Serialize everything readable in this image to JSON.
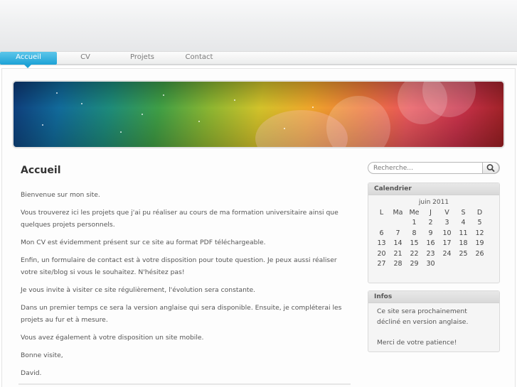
{
  "nav": {
    "items": [
      {
        "label": "Accueil",
        "active": true
      },
      {
        "label": "CV",
        "active": false
      },
      {
        "label": "Projets",
        "active": false
      },
      {
        "label": "Contact",
        "active": false
      }
    ]
  },
  "main": {
    "title": "Accueil",
    "paragraphs": [
      "Bienvenue sur mon site.",
      "Vous trouverez ici les projets que j'ai pu réaliser au cours de ma formation universitaire ainsi que quelques projets personnels.",
      "Mon CV est évidemment présent sur ce site au format PDF téléchargeable.",
      "Enfin, un formulaire de contact est à votre disposition pour toute question. Je peux aussi réaliser votre site/blog si vous le souhaitez. N'hésitez pas!",
      "Je vous invite à visiter ce site régulièrement, l'évolution sera constante.",
      "Dans un premier temps ce sera la version anglaise qui sera disponible. Ensuite, je compléterai les projets au fur et à mesure.",
      "Vous avez également à votre disposition un site mobile.",
      "Bonne visite,",
      "David."
    ]
  },
  "search": {
    "placeholder": "Recherche..."
  },
  "calendar": {
    "title": "Calendrier",
    "caption": "juin 2011",
    "weekdays": [
      "L",
      "Ma",
      "Me",
      "J",
      "V",
      "S",
      "D"
    ],
    "weeks": [
      [
        "",
        "",
        "1",
        "2",
        "3",
        "4",
        "5"
      ],
      [
        "6",
        "7",
        "8",
        "9",
        "10",
        "11",
        "12"
      ],
      [
        "13",
        "14",
        "15",
        "16",
        "17",
        "18",
        "19"
      ],
      [
        "20",
        "21",
        "22",
        "23",
        "24",
        "25",
        "26"
      ],
      [
        "27",
        "28",
        "29",
        "30",
        "",
        "",
        ""
      ]
    ]
  },
  "infos": {
    "title": "Infos",
    "line1": "Ce site sera prochainement décliné en version anglaise.",
    "line2": "Merci de votre patience!"
  },
  "colors": {
    "nav_active": "#1da2d6",
    "nav_text": "#7a7a7a",
    "title": "#333333",
    "body_text": "#555555"
  },
  "icons": {
    "search_button": "magnifier-icon"
  }
}
